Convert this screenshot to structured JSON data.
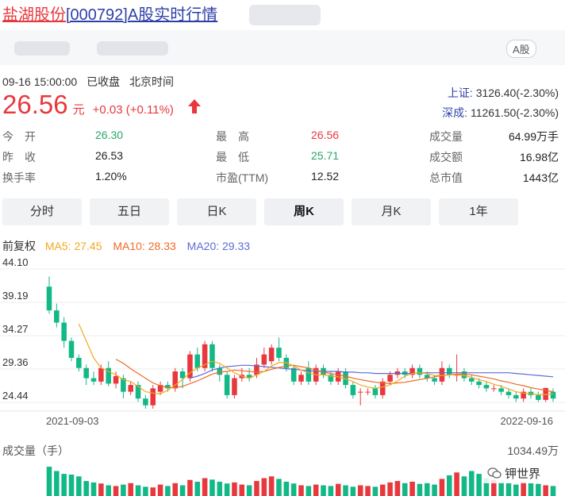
{
  "header": {
    "stock_name": "盐湖股份",
    "stock_code": "[000792]",
    "title_suffix": "A股实时行情",
    "market_badge": "A股"
  },
  "status": {
    "datetime": "09-16 15:00:00",
    "state": "已收盘",
    "timezone": "北京时间"
  },
  "quote": {
    "price": "26.56",
    "currency": "元",
    "change": "+0.03 (+0.11%)",
    "arrow": "up-arrow-icon"
  },
  "indices": [
    {
      "label": "上证:",
      "value": "3126.40(-2.30%)"
    },
    {
      "label": "深成:",
      "value": "11261.50(-2.30%)"
    }
  ],
  "stats": [
    {
      "label": "今　开",
      "value": "26.30",
      "color": "green"
    },
    {
      "label": "最　高",
      "value": "26.56",
      "color": "red"
    },
    {
      "label": "成交量",
      "value": "64.99万手",
      "color": "normal"
    },
    {
      "label": "昨　收",
      "value": "26.53",
      "color": "normal"
    },
    {
      "label": "最　低",
      "value": "25.71",
      "color": "green"
    },
    {
      "label": "成交额",
      "value": "16.98亿",
      "color": "normal"
    },
    {
      "label": "换手率",
      "value": "1.20%",
      "color": "normal"
    },
    {
      "label": "市盈(TTM)",
      "value": "12.52",
      "color": "normal"
    },
    {
      "label": "总市值",
      "value": "1443亿",
      "color": "normal"
    }
  ],
  "tabs": [
    {
      "label": "分时",
      "active": false
    },
    {
      "label": "五日",
      "active": false
    },
    {
      "label": "日K",
      "active": false
    },
    {
      "label": "周K",
      "active": true
    },
    {
      "label": "月K",
      "active": false
    },
    {
      "label": "1年",
      "active": false
    }
  ],
  "ma_legend": {
    "adjust": "前复权",
    "ma5": "MA5: 27.45",
    "ma10": "MA10: 28.33",
    "ma20": "MA20: 29.33"
  },
  "colors": {
    "up": "#e8383d",
    "down": "#12b886",
    "ma5": "#f4a81d",
    "ma10": "#ee6b27",
    "ma20": "#5b6cd6"
  },
  "chart_data": {
    "type": "candlestick",
    "y_ticks": [
      "44.10",
      "39.19",
      "34.27",
      "29.36",
      "24.44"
    ],
    "ylim": [
      23.5,
      44.1
    ],
    "x_labels": [
      "2021-09-03",
      "2022-09-16"
    ],
    "candles": [
      [
        41.5,
        38.0,
        43.0,
        37.5
      ],
      [
        38.0,
        36.2,
        39.0,
        35.5
      ],
      [
        36.2,
        33.5,
        37.0,
        32.5
      ],
      [
        33.5,
        31.0,
        34.0,
        30.5
      ],
      [
        31.0,
        29.5,
        31.5,
        29.0
      ],
      [
        29.5,
        28.0,
        30.0,
        27.0
      ],
      [
        28.0,
        27.5,
        29.0,
        27.0
      ],
      [
        27.5,
        29.5,
        30.0,
        27.0
      ],
      [
        29.5,
        27.2,
        30.5,
        26.8
      ],
      [
        27.2,
        28.3,
        29.0,
        26.5
      ],
      [
        28.0,
        26.0,
        28.5,
        25.0
      ],
      [
        26.0,
        27.0,
        27.5,
        25.5
      ],
      [
        27.0,
        25.0,
        27.5,
        24.5
      ],
      [
        25.0,
        24.0,
        25.5,
        23.5
      ],
      [
        24.0,
        26.5,
        27.0,
        23.5
      ],
      [
        26.0,
        27.0,
        27.5,
        25.5
      ],
      [
        27.0,
        26.5,
        27.5,
        26.0
      ],
      [
        26.5,
        29.0,
        29.5,
        26.0
      ],
      [
        29.0,
        28.0,
        29.5,
        26.5
      ],
      [
        28.0,
        31.5,
        32.0,
        27.5
      ],
      [
        31.5,
        29.5,
        32.5,
        29.0
      ],
      [
        29.5,
        33.0,
        33.5,
        29.0
      ],
      [
        33.0,
        29.5,
        33.5,
        29.0
      ],
      [
        29.5,
        28.5,
        30.0,
        27.5
      ],
      [
        28.5,
        25.5,
        29.0,
        25.0
      ],
      [
        25.5,
        28.0,
        28.5,
        25.0
      ],
      [
        28.0,
        28.5,
        29.5,
        27.5
      ],
      [
        28.5,
        28.0,
        29.5,
        27.5
      ],
      [
        28.5,
        30.0,
        31.0,
        28.0
      ],
      [
        30.0,
        31.5,
        32.5,
        29.5
      ],
      [
        30.5,
        32.5,
        33.0,
        30.0
      ],
      [
        32.5,
        31.0,
        34.0,
        30.5
      ],
      [
        31.0,
        29.5,
        31.5,
        29.0
      ],
      [
        29.5,
        27.5,
        30.0,
        27.0
      ],
      [
        27.5,
        28.5,
        29.0,
        27.0
      ],
      [
        29.5,
        27.5,
        30.5,
        27.0
      ],
      [
        27.5,
        29.5,
        30.0,
        27.0
      ],
      [
        29.5,
        28.5,
        30.0,
        28.0
      ],
      [
        28.5,
        27.5,
        29.0,
        27.0
      ],
      [
        27.5,
        29.0,
        29.5,
        27.0
      ],
      [
        29.0,
        27.0,
        29.5,
        26.5
      ],
      [
        27.0,
        25.5,
        27.5,
        25.0
      ],
      [
        26.0,
        26.0,
        26.5,
        24.0
      ],
      [
        26.0,
        26.0,
        26.5,
        25.5
      ],
      [
        26.5,
        25.5,
        27.0,
        25.0
      ],
      [
        25.5,
        27.5,
        28.0,
        25.0
      ],
      [
        27.5,
        28.5,
        29.0,
        27.0
      ],
      [
        28.5,
        29.0,
        29.5,
        28.0
      ],
      [
        29.0,
        28.5,
        29.5,
        28.0
      ],
      [
        28.5,
        29.5,
        30.0,
        28.0
      ],
      [
        29.5,
        28.5,
        30.0,
        28.0
      ],
      [
        28.5,
        28.0,
        29.0,
        27.5
      ],
      [
        28.0,
        27.5,
        28.5,
        27.0
      ],
      [
        27.5,
        29.5,
        30.5,
        27.0
      ],
      [
        29.5,
        28.5,
        30.0,
        28.0
      ],
      [
        28.5,
        28.5,
        31.5,
        27.5
      ],
      [
        29.0,
        28.0,
        29.5,
        27.5
      ],
      [
        28.0,
        27.5,
        28.5,
        27.0
      ],
      [
        27.5,
        27.0,
        28.0,
        26.5
      ],
      [
        27.0,
        26.5,
        27.5,
        26.0
      ],
      [
        26.5,
        26.5,
        27.0,
        26.0
      ],
      [
        26.5,
        26.0,
        27.0,
        25.5
      ],
      [
        26.0,
        25.5,
        26.5,
        25.0
      ],
      [
        25.5,
        25.0,
        26.0,
        24.5
      ],
      [
        25.0,
        26.0,
        26.5,
        24.5
      ],
      [
        26.0,
        25.5,
        26.5,
        25.0
      ],
      [
        25.5,
        24.8,
        26.0,
        24.5
      ],
      [
        24.8,
        26.56,
        26.56,
        24.5
      ],
      [
        26.0,
        25.0,
        26.5,
        24.5
      ]
    ],
    "ma5": [
      null,
      null,
      null,
      null,
      36.0,
      33.5,
      31.0,
      29.5,
      29.0,
      28.5,
      27.8,
      27.5,
      26.8,
      26.0,
      25.8,
      25.7,
      26.2,
      27.0,
      27.8,
      28.8,
      29.5,
      30.0,
      30.5,
      30.2,
      29.5,
      28.8,
      28.3,
      28.0,
      28.5,
      29.0,
      29.8,
      30.3,
      30.3,
      29.8,
      29.2,
      28.8,
      28.5,
      28.5,
      28.3,
      28.2,
      27.9,
      27.5,
      27.0,
      26.7,
      26.5,
      26.7,
      27.0,
      27.6,
      28.3,
      28.7,
      28.8,
      28.7,
      28.4,
      28.4,
      28.5,
      28.5,
      28.4,
      28.1,
      27.8,
      27.5,
      27.1,
      26.8,
      26.4,
      26.0,
      25.8,
      25.7,
      25.6,
      25.6,
      25.7
    ],
    "ma10": [
      null,
      null,
      null,
      null,
      null,
      null,
      null,
      null,
      null,
      30.8,
      30.2,
      29.4,
      28.7,
      28.0,
      27.3,
      26.9,
      26.6,
      26.6,
      26.8,
      27.2,
      27.6,
      28.1,
      28.6,
      28.9,
      29.0,
      29.2,
      29.1,
      29.0,
      28.9,
      29.0,
      29.3,
      29.6,
      29.8,
      29.9,
      29.7,
      29.5,
      29.2,
      28.9,
      28.7,
      28.5,
      28.3,
      28.0,
      27.8,
      27.6,
      27.4,
      27.3,
      27.2,
      27.3,
      27.4,
      27.6,
      27.8,
      28.0,
      28.2,
      28.4,
      28.5,
      28.6,
      28.6,
      28.5,
      28.3,
      28.1,
      27.9,
      27.6,
      27.4,
      27.1,
      26.9,
      26.6,
      26.4,
      26.2,
      26.0
    ],
    "ma20": [
      null,
      null,
      null,
      null,
      null,
      null,
      null,
      null,
      null,
      null,
      null,
      null,
      null,
      null,
      null,
      null,
      null,
      null,
      null,
      28.0,
      28.3,
      28.7,
      29.2,
      29.5,
      29.7,
      29.8,
      29.9,
      29.9,
      29.8,
      29.7,
      29.6,
      29.5,
      29.4,
      29.3,
      29.2,
      29.1,
      29.0,
      29.0,
      29.0,
      29.0,
      28.9,
      28.9,
      28.8,
      28.8,
      28.7,
      28.7,
      28.7,
      28.7,
      28.7,
      28.7,
      28.8,
      28.8,
      28.8,
      28.8,
      28.8,
      28.8,
      28.8,
      28.8,
      28.8,
      28.8,
      28.8,
      28.8,
      28.8,
      28.7,
      28.6,
      28.5,
      28.4,
      28.3,
      28.2
    ]
  },
  "volume": {
    "label": "成交量（手）",
    "max_label": "1034.49万",
    "values": [
      0.82,
      0.7,
      0.62,
      0.6,
      0.55,
      0.42,
      0.38,
      0.35,
      0.3,
      0.28,
      0.32,
      0.36,
      0.3,
      0.26,
      0.24,
      0.32,
      0.28,
      0.36,
      0.3,
      0.45,
      0.4,
      0.5,
      0.46,
      0.4,
      0.35,
      0.38,
      0.32,
      0.3,
      0.42,
      0.5,
      0.55,
      0.48,
      0.4,
      0.35,
      0.3,
      0.28,
      0.32,
      0.3,
      0.28,
      0.34,
      0.3,
      0.26,
      0.3,
      0.28,
      0.26,
      0.32,
      0.38,
      0.42,
      0.36,
      0.4,
      0.34,
      0.36,
      0.32,
      0.48,
      0.58,
      0.66,
      0.55,
      0.7,
      0.62,
      0.5,
      0.45,
      0.4,
      0.36,
      0.32,
      0.4,
      0.36,
      0.34,
      0.3,
      0.28
    ]
  },
  "watermark": "钾世界"
}
